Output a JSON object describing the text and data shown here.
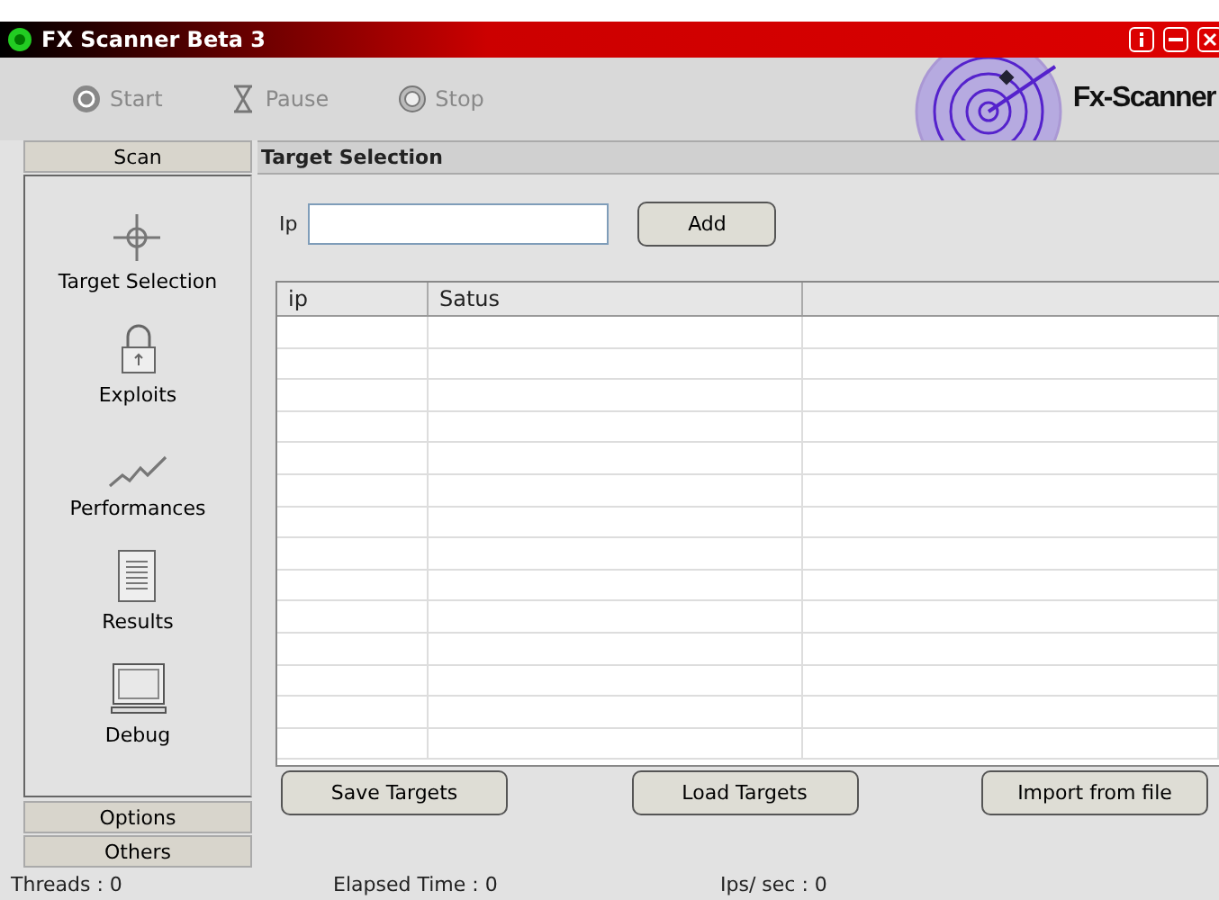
{
  "window": {
    "title": "FX Scanner Beta 3"
  },
  "toolbar": [
    {
      "label": "Start",
      "disabled": true
    },
    {
      "label": "Pause",
      "disabled": true
    },
    {
      "label": "Stop",
      "disabled": true
    }
  ],
  "logo": {
    "text": "Fx-Scanner"
  },
  "sidebar": {
    "sections": [
      {
        "label": "Scan"
      },
      {
        "label": "Options"
      },
      {
        "label": "Others"
      }
    ],
    "items": [
      {
        "label": "Target Selection"
      },
      {
        "label": "Exploits"
      },
      {
        "label": "Performances"
      },
      {
        "label": "Results"
      },
      {
        "label": "Debug"
      }
    ]
  },
  "panel": {
    "title": "Target Selection",
    "ip_label": "Ip",
    "add_button": "Add"
  },
  "table": {
    "columns": [
      "ip",
      "Satus"
    ]
  },
  "buttons": [
    "Save Targets",
    "Load Targets",
    "Import from file"
  ],
  "status_bar": [
    "Threads : 0",
    "Elapsed Time : 0",
    "Ips/ sec : 0"
  ]
}
